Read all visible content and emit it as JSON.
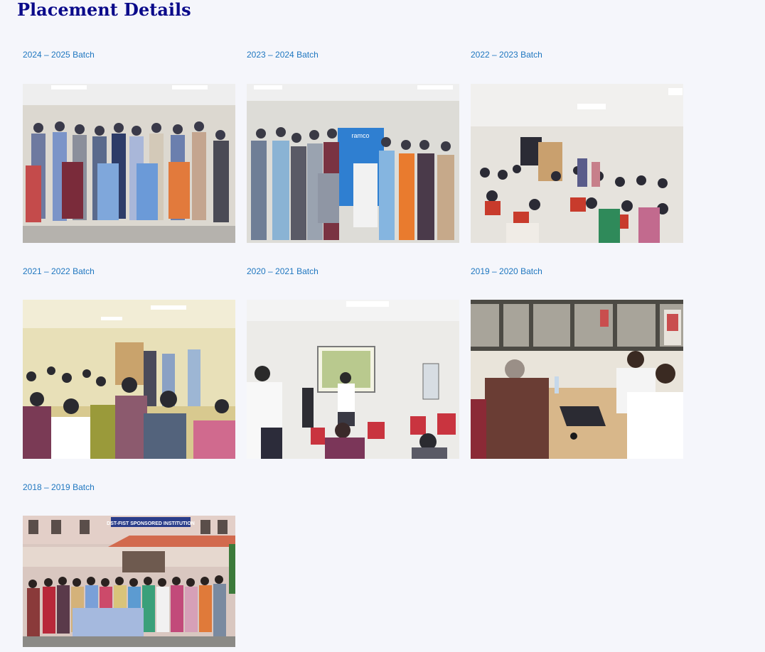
{
  "page": {
    "title": "Placement Details"
  },
  "batches": [
    {
      "label": "2024 – 2025 Batch",
      "photo": "group-photo"
    },
    {
      "label": "2023 – 2024 Batch",
      "photo": "group-photo"
    },
    {
      "label": "2022 – 2023 Batch",
      "photo": "classroom-photo"
    },
    {
      "label": "2021 – 2022 Batch",
      "photo": "classroom-photo"
    },
    {
      "label": "2020 – 2021 Batch",
      "photo": "classroom-photo"
    },
    {
      "label": "2019 – 2020 Batch",
      "photo": "meeting-photo"
    },
    {
      "label": "2018 – 2019 Batch",
      "photo": "group-photo"
    }
  ],
  "photo_texts": {
    "ramco_banner": "ramco",
    "institution_sign": "DST-FIST SPONSORED INSTITUTION"
  },
  "colors": {
    "title": "#0a0a8a",
    "link": "#1f77c0",
    "background": "#f5f6fb"
  }
}
